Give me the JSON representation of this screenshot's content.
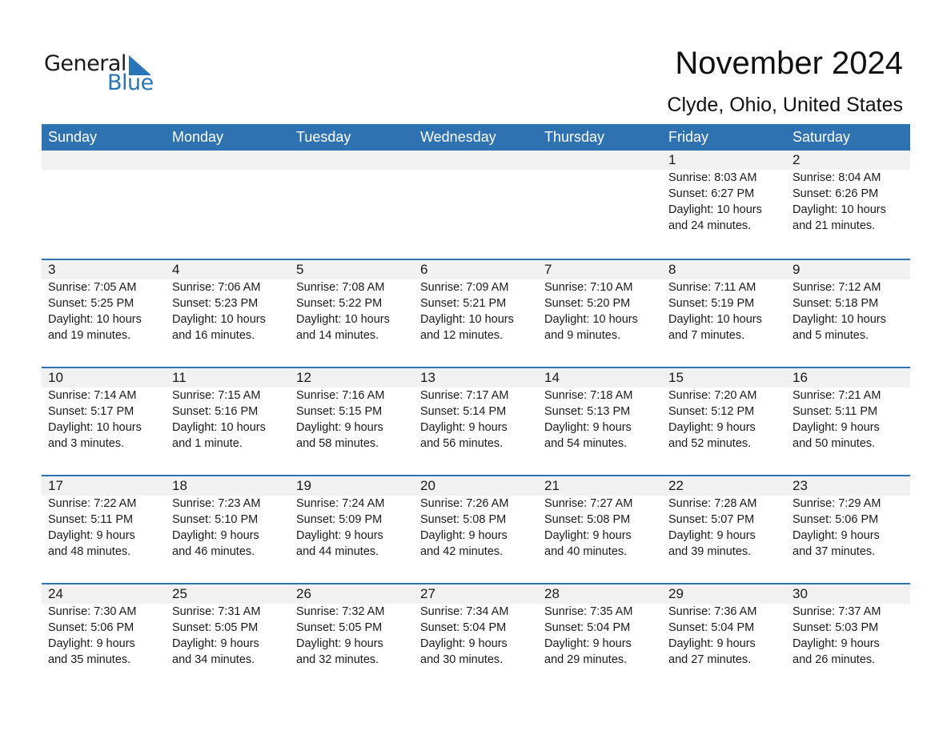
{
  "logo": {
    "line1": "General",
    "line2": "Blue",
    "brand_color": "#2a74b8"
  },
  "header": {
    "title": "November 2024",
    "location": "Clyde, Ohio, United States"
  },
  "colors": {
    "header_bg": "#2e72b2",
    "band_bg": "#f1f1f1"
  },
  "weekdays": [
    "Sunday",
    "Monday",
    "Tuesday",
    "Wednesday",
    "Thursday",
    "Friday",
    "Saturday"
  ],
  "weeks": [
    [
      null,
      null,
      null,
      null,
      null,
      {
        "day": "1",
        "sunrise": "Sunrise: 8:03 AM",
        "sunset": "Sunset: 6:27 PM",
        "daylight1": "Daylight: 10 hours",
        "daylight2": "and 24 minutes."
      },
      {
        "day": "2",
        "sunrise": "Sunrise: 8:04 AM",
        "sunset": "Sunset: 6:26 PM",
        "daylight1": "Daylight: 10 hours",
        "daylight2": "and 21 minutes."
      }
    ],
    [
      {
        "day": "3",
        "sunrise": "Sunrise: 7:05 AM",
        "sunset": "Sunset: 5:25 PM",
        "daylight1": "Daylight: 10 hours",
        "daylight2": "and 19 minutes."
      },
      {
        "day": "4",
        "sunrise": "Sunrise: 7:06 AM",
        "sunset": "Sunset: 5:23 PM",
        "daylight1": "Daylight: 10 hours",
        "daylight2": "and 16 minutes."
      },
      {
        "day": "5",
        "sunrise": "Sunrise: 7:08 AM",
        "sunset": "Sunset: 5:22 PM",
        "daylight1": "Daylight: 10 hours",
        "daylight2": "and 14 minutes."
      },
      {
        "day": "6",
        "sunrise": "Sunrise: 7:09 AM",
        "sunset": "Sunset: 5:21 PM",
        "daylight1": "Daylight: 10 hours",
        "daylight2": "and 12 minutes."
      },
      {
        "day": "7",
        "sunrise": "Sunrise: 7:10 AM",
        "sunset": "Sunset: 5:20 PM",
        "daylight1": "Daylight: 10 hours",
        "daylight2": "and 9 minutes."
      },
      {
        "day": "8",
        "sunrise": "Sunrise: 7:11 AM",
        "sunset": "Sunset: 5:19 PM",
        "daylight1": "Daylight: 10 hours",
        "daylight2": "and 7 minutes."
      },
      {
        "day": "9",
        "sunrise": "Sunrise: 7:12 AM",
        "sunset": "Sunset: 5:18 PM",
        "daylight1": "Daylight: 10 hours",
        "daylight2": "and 5 minutes."
      }
    ],
    [
      {
        "day": "10",
        "sunrise": "Sunrise: 7:14 AM",
        "sunset": "Sunset: 5:17 PM",
        "daylight1": "Daylight: 10 hours",
        "daylight2": "and 3 minutes."
      },
      {
        "day": "11",
        "sunrise": "Sunrise: 7:15 AM",
        "sunset": "Sunset: 5:16 PM",
        "daylight1": "Daylight: 10 hours",
        "daylight2": "and 1 minute."
      },
      {
        "day": "12",
        "sunrise": "Sunrise: 7:16 AM",
        "sunset": "Sunset: 5:15 PM",
        "daylight1": "Daylight: 9 hours",
        "daylight2": "and 58 minutes."
      },
      {
        "day": "13",
        "sunrise": "Sunrise: 7:17 AM",
        "sunset": "Sunset: 5:14 PM",
        "daylight1": "Daylight: 9 hours",
        "daylight2": "and 56 minutes."
      },
      {
        "day": "14",
        "sunrise": "Sunrise: 7:18 AM",
        "sunset": "Sunset: 5:13 PM",
        "daylight1": "Daylight: 9 hours",
        "daylight2": "and 54 minutes."
      },
      {
        "day": "15",
        "sunrise": "Sunrise: 7:20 AM",
        "sunset": "Sunset: 5:12 PM",
        "daylight1": "Daylight: 9 hours",
        "daylight2": "and 52 minutes."
      },
      {
        "day": "16",
        "sunrise": "Sunrise: 7:21 AM",
        "sunset": "Sunset: 5:11 PM",
        "daylight1": "Daylight: 9 hours",
        "daylight2": "and 50 minutes."
      }
    ],
    [
      {
        "day": "17",
        "sunrise": "Sunrise: 7:22 AM",
        "sunset": "Sunset: 5:11 PM",
        "daylight1": "Daylight: 9 hours",
        "daylight2": "and 48 minutes."
      },
      {
        "day": "18",
        "sunrise": "Sunrise: 7:23 AM",
        "sunset": "Sunset: 5:10 PM",
        "daylight1": "Daylight: 9 hours",
        "daylight2": "and 46 minutes."
      },
      {
        "day": "19",
        "sunrise": "Sunrise: 7:24 AM",
        "sunset": "Sunset: 5:09 PM",
        "daylight1": "Daylight: 9 hours",
        "daylight2": "and 44 minutes."
      },
      {
        "day": "20",
        "sunrise": "Sunrise: 7:26 AM",
        "sunset": "Sunset: 5:08 PM",
        "daylight1": "Daylight: 9 hours",
        "daylight2": "and 42 minutes."
      },
      {
        "day": "21",
        "sunrise": "Sunrise: 7:27 AM",
        "sunset": "Sunset: 5:08 PM",
        "daylight1": "Daylight: 9 hours",
        "daylight2": "and 40 minutes."
      },
      {
        "day": "22",
        "sunrise": "Sunrise: 7:28 AM",
        "sunset": "Sunset: 5:07 PM",
        "daylight1": "Daylight: 9 hours",
        "daylight2": "and 39 minutes."
      },
      {
        "day": "23",
        "sunrise": "Sunrise: 7:29 AM",
        "sunset": "Sunset: 5:06 PM",
        "daylight1": "Daylight: 9 hours",
        "daylight2": "and 37 minutes."
      }
    ],
    [
      {
        "day": "24",
        "sunrise": "Sunrise: 7:30 AM",
        "sunset": "Sunset: 5:06 PM",
        "daylight1": "Daylight: 9 hours",
        "daylight2": "and 35 minutes."
      },
      {
        "day": "25",
        "sunrise": "Sunrise: 7:31 AM",
        "sunset": "Sunset: 5:05 PM",
        "daylight1": "Daylight: 9 hours",
        "daylight2": "and 34 minutes."
      },
      {
        "day": "26",
        "sunrise": "Sunrise: 7:32 AM",
        "sunset": "Sunset: 5:05 PM",
        "daylight1": "Daylight: 9 hours",
        "daylight2": "and 32 minutes."
      },
      {
        "day": "27",
        "sunrise": "Sunrise: 7:34 AM",
        "sunset": "Sunset: 5:04 PM",
        "daylight1": "Daylight: 9 hours",
        "daylight2": "and 30 minutes."
      },
      {
        "day": "28",
        "sunrise": "Sunrise: 7:35 AM",
        "sunset": "Sunset: 5:04 PM",
        "daylight1": "Daylight: 9 hours",
        "daylight2": "and 29 minutes."
      },
      {
        "day": "29",
        "sunrise": "Sunrise: 7:36 AM",
        "sunset": "Sunset: 5:04 PM",
        "daylight1": "Daylight: 9 hours",
        "daylight2": "and 27 minutes."
      },
      {
        "day": "30",
        "sunrise": "Sunrise: 7:37 AM",
        "sunset": "Sunset: 5:03 PM",
        "daylight1": "Daylight: 9 hours",
        "daylight2": "and 26 minutes."
      }
    ]
  ]
}
